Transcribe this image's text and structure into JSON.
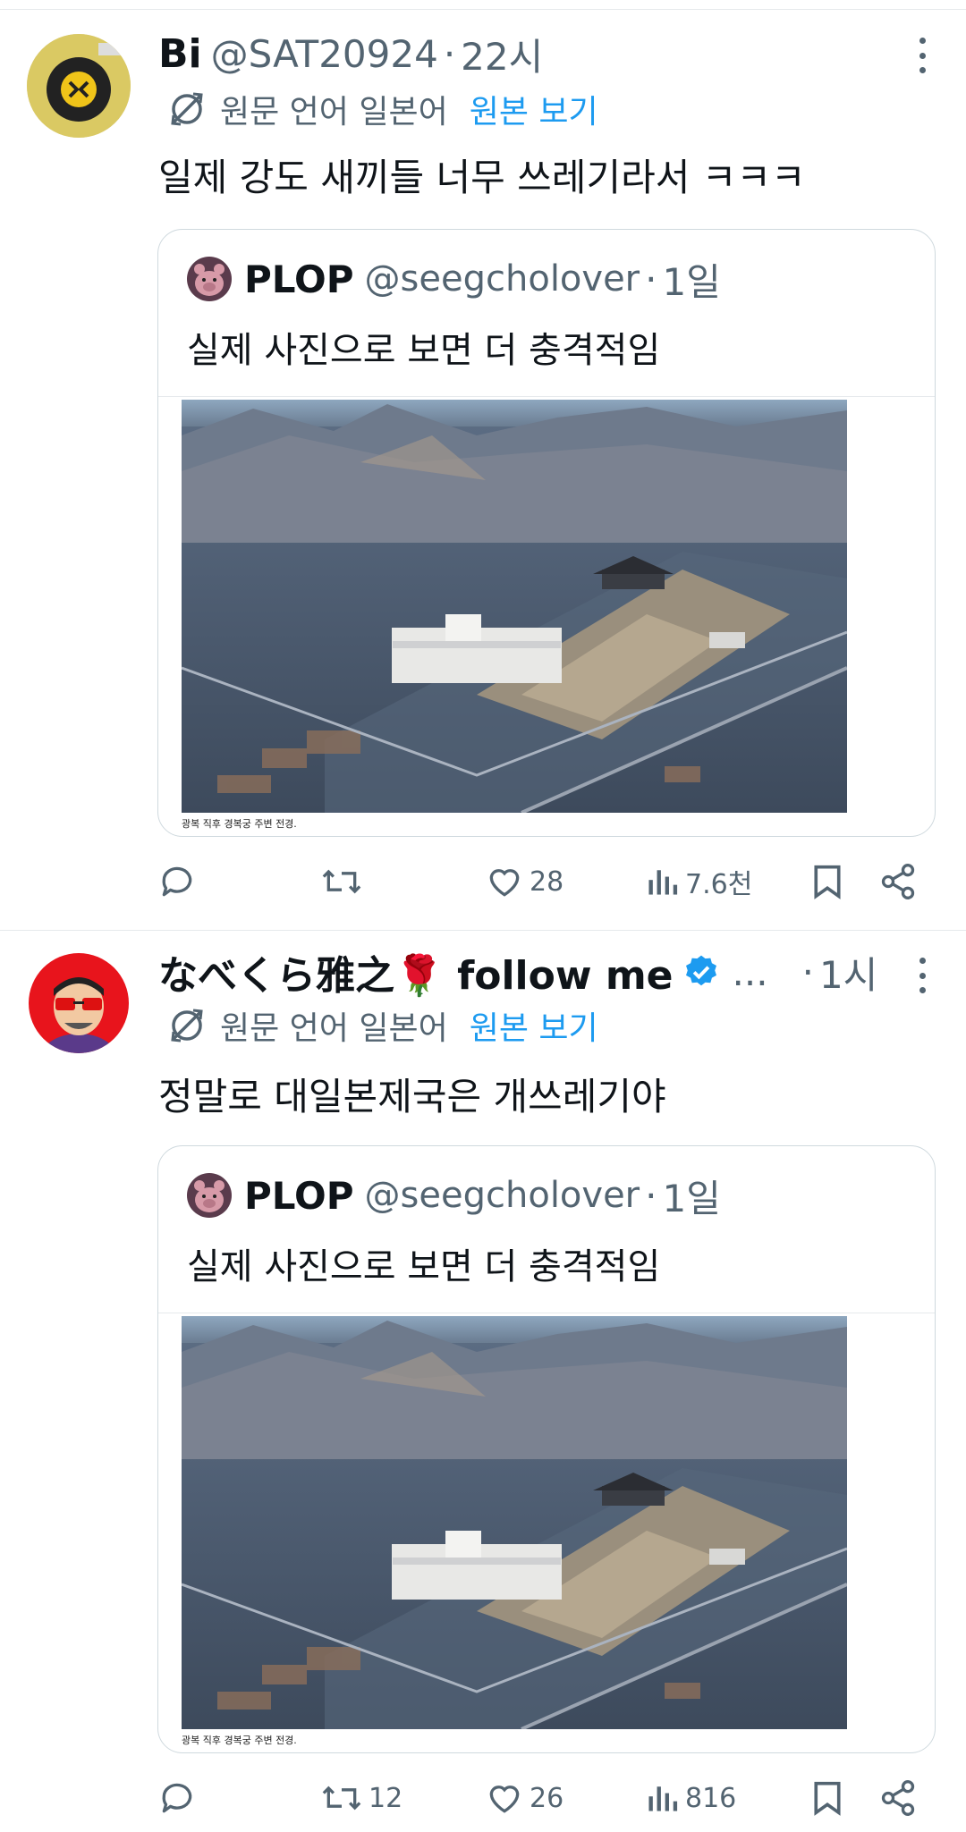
{
  "tweets": [
    {
      "author_name": "Bi",
      "handle": "@SAT20924",
      "separator": "·",
      "time": "22시",
      "translate_label": "원문 언어 일본어",
      "translate_link": "원본 보기",
      "text": "일제 강도 새끼들 너무 쓰레기라서 ㅋㅋㅋ",
      "quote": {
        "name": "PLOP",
        "handle": "@seegcholover",
        "separator": "·",
        "time": "1일",
        "text": "실제 사진으로 보면 더 충격적임",
        "photo_caption": "광복 직후 경복궁 주변 전경."
      },
      "actions": {
        "reply": "",
        "retweet": "",
        "like": "28",
        "views": "7.6천"
      }
    },
    {
      "author_name": "なべくら雅之🌹 follow me",
      "verified_ellipsis": "...",
      "separator": "·",
      "time": "1시",
      "translate_label": "원문 언어 일본어",
      "translate_link": "원본 보기",
      "text": "정말로 대일본제국은 개쓰레기야",
      "quote": {
        "name": "PLOP",
        "handle": "@seegcholover",
        "separator": "·",
        "time": "1일",
        "text": "실제 사진으로 보면 더 충격적임",
        "photo_caption": "광복 직후 경복궁 주변 전경."
      },
      "actions": {
        "reply": "",
        "retweet": "12",
        "like": "26",
        "views": "816"
      }
    }
  ],
  "colors": {
    "accent": "#1d9bf0",
    "muted": "#536471",
    "text": "#0f1419",
    "border": "#cfd9de"
  },
  "icons": [
    "translate-icon",
    "more-icon",
    "reply-icon",
    "retweet-icon",
    "like-icon",
    "views-icon",
    "bookmark-icon",
    "share-icon",
    "verified-icon"
  ]
}
